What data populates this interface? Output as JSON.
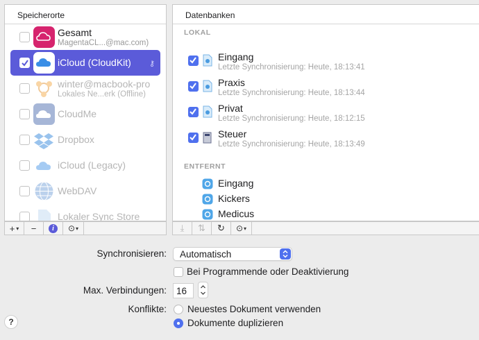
{
  "left_panel": {
    "header": "Speicherorte",
    "items": [
      {
        "name": "Gesamt",
        "sub": "MagentaCL...@mac.com)",
        "checked": false,
        "icon": "magenta-cloud-icon"
      },
      {
        "name": "iCloud (CloudKit)",
        "sub": "",
        "checked": true,
        "icon": "icloud-icon",
        "selected": true
      },
      {
        "name": "winter@macbook-pro",
        "sub": "Lokales Ne...erk (Offline)",
        "checked": false,
        "icon": "network-icon"
      },
      {
        "name": "CloudMe",
        "sub": "",
        "checked": false,
        "icon": "cloudme-icon"
      },
      {
        "name": "Dropbox",
        "sub": "",
        "checked": false,
        "icon": "dropbox-icon"
      },
      {
        "name": "iCloud (Legacy)",
        "sub": "",
        "checked": false,
        "icon": "icloud-legacy-icon"
      },
      {
        "name": "WebDAV",
        "sub": "",
        "checked": false,
        "icon": "webdav-globe-icon"
      },
      {
        "name": "Lokaler Sync Store",
        "sub": "",
        "checked": false,
        "icon": "local-sync-icon"
      }
    ],
    "toolbar": {
      "add": "+",
      "remove": "−",
      "info": "i"
    }
  },
  "right_panel": {
    "header": "Datenbanken",
    "local_label": "LOKAL",
    "local_items": [
      {
        "name": "Eingang",
        "sub": "Letzte Synchronisierung: Heute, 18:13:41"
      },
      {
        "name": "Praxis",
        "sub": "Letzte Synchronisierung: Heute, 18:13:44"
      },
      {
        "name": "Privat",
        "sub": "Letzte Synchronisierung: Heute, 18:12:15"
      },
      {
        "name": "Steuer",
        "sub": "Letzte Synchronisierung: Heute, 18:13:49"
      }
    ],
    "remote_label": "ENTFERNT",
    "remote_items": [
      {
        "name": "Eingang"
      },
      {
        "name": "Kickers"
      },
      {
        "name": "Medicus"
      }
    ]
  },
  "form": {
    "sync_label": "Synchronisieren:",
    "sync_value": "Automatisch",
    "quit_option": "Bei Programmende oder Deaktivierung",
    "max_label": "Max. Verbindungen:",
    "max_value": "16",
    "conflict_label": "Konflikte:",
    "conflict_options": [
      "Neuestes Dokument verwenden",
      "Dokumente duplizieren"
    ],
    "conflict_selected": 1
  },
  "help": "?",
  "colors": {
    "accent": "#5b5bd9",
    "checkbox": "#4f70ee",
    "magenta": "#d6246e"
  }
}
